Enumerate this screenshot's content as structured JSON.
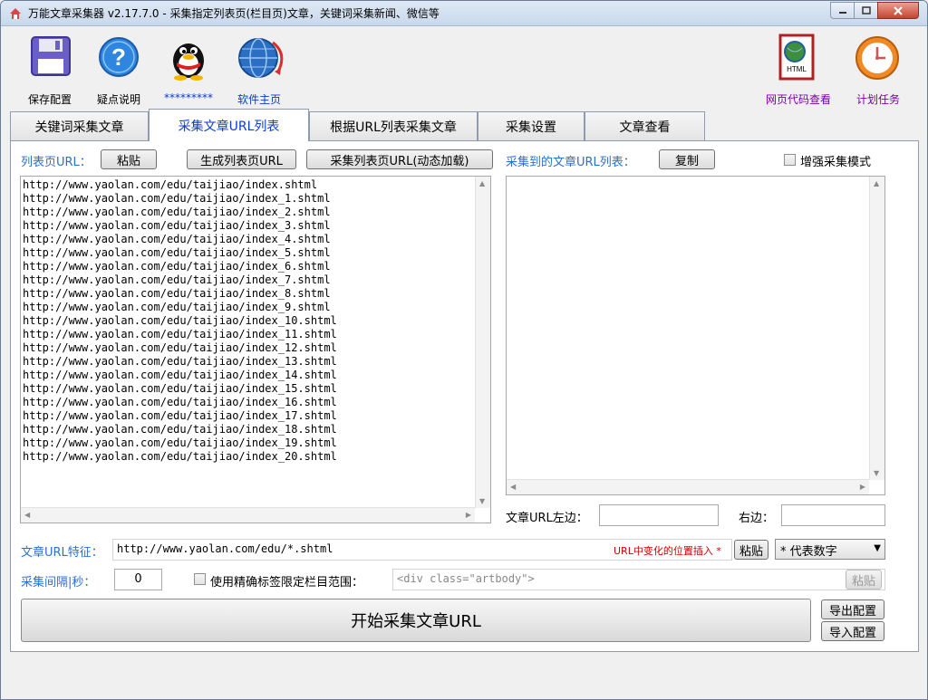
{
  "window": {
    "title": "万能文章采集器 v2.17.7.0 - 采集指定列表页(栏目页)文章，关键词采集新闻、微信等"
  },
  "toolbar": {
    "save_config": "保存配置",
    "faq": "疑点说明",
    "qq": "*********",
    "homepage": "软件主页",
    "html_viewer": "网页代码查看",
    "schedule": "计划任务",
    "html_badge": "HTML"
  },
  "tabs": [
    {
      "label": "关键词采集文章"
    },
    {
      "label": "采集文章URL列表"
    },
    {
      "label": "根据URL列表采集文章"
    },
    {
      "label": "采集设置"
    },
    {
      "label": "文章查看"
    }
  ],
  "left": {
    "list_url_label": "列表页URL：",
    "paste_button": "粘贴",
    "generate_button": "生成列表页URL",
    "collect_dynamic_button": "采集列表页URL(动态加载)",
    "urls": [
      "http://www.yaolan.com/edu/taijiao/index.shtml",
      "http://www.yaolan.com/edu/taijiao/index_1.shtml",
      "http://www.yaolan.com/edu/taijiao/index_2.shtml",
      "http://www.yaolan.com/edu/taijiao/index_3.shtml",
      "http://www.yaolan.com/edu/taijiao/index_4.shtml",
      "http://www.yaolan.com/edu/taijiao/index_5.shtml",
      "http://www.yaolan.com/edu/taijiao/index_6.shtml",
      "http://www.yaolan.com/edu/taijiao/index_7.shtml",
      "http://www.yaolan.com/edu/taijiao/index_8.shtml",
      "http://www.yaolan.com/edu/taijiao/index_9.shtml",
      "http://www.yaolan.com/edu/taijiao/index_10.shtml",
      "http://www.yaolan.com/edu/taijiao/index_11.shtml",
      "http://www.yaolan.com/edu/taijiao/index_12.shtml",
      "http://www.yaolan.com/edu/taijiao/index_13.shtml",
      "http://www.yaolan.com/edu/taijiao/index_14.shtml",
      "http://www.yaolan.com/edu/taijiao/index_15.shtml",
      "http://www.yaolan.com/edu/taijiao/index_16.shtml",
      "http://www.yaolan.com/edu/taijiao/index_17.shtml",
      "http://www.yaolan.com/edu/taijiao/index_18.shtml",
      "http://www.yaolan.com/edu/taijiao/index_19.shtml",
      "http://www.yaolan.com/edu/taijiao/index_20.shtml"
    ]
  },
  "right": {
    "collected_label": "采集到的文章URL列表：",
    "copy_button": "复制",
    "enhanced_mode_label": "增强采集模式",
    "enhanced_mode_checked": false,
    "left_edge_label": "文章URL左边：",
    "left_edge_value": "",
    "right_edge_label": "右边：",
    "right_edge_value": ""
  },
  "bottom": {
    "feature_label": "文章URL特征：",
    "feature_value": "http://www.yaolan.com/edu/*.shtml",
    "insert_hint": "URL中变化的位置插入 *",
    "paste_button": "粘贴",
    "select_value": "* 代表数字",
    "interval_label": "采集间隔|秒：",
    "interval_value": "0",
    "precise_tag_label": "使用精确标签限定栏目范围：",
    "precise_tag_checked": false,
    "precise_tag_placeholder": "<div class=\"artbody\">",
    "paste_disabled_button": "粘贴",
    "start_button": "开始采集文章URL",
    "export_button": "导出配置",
    "import_button": "导入配置"
  },
  "colors": {
    "label_blue": "#2a6fd1",
    "tab_active_text": "#0a3cd0",
    "purple_label": "#7b00a8",
    "hint_red": "#cc0000"
  }
}
